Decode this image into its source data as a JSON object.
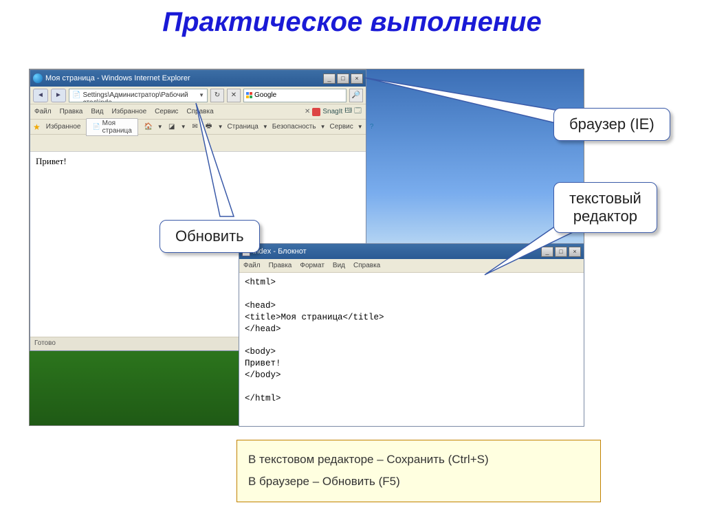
{
  "title": "Практическое выполнение",
  "ie": {
    "title": "Моя страница - Windows Internet Explorer",
    "address": "C:\\Documents and Settings\\Администратор\\Рабочий стол\\inde",
    "search": "Google",
    "menu": {
      "file": "Файл",
      "edit": "Правка",
      "view": "Вид",
      "favorites": "Избранное",
      "service": "Сервис",
      "help": "Справка"
    },
    "snagit": "SnagIt",
    "favbar": {
      "fav": "Избранное",
      "tab": "Моя страница"
    },
    "toolbar": {
      "page": "Страница",
      "security": "Безопасность",
      "service": "Сервис"
    },
    "content": "Привет!",
    "status": "Готово"
  },
  "notepad": {
    "title": "index - Блокнот",
    "menu": {
      "file": "Файл",
      "edit": "Правка",
      "format": "Формат",
      "view": "Вид",
      "help": "Справка"
    },
    "body": "<html>\n\n<head>\n<title>Моя страница</title>\n</head>\n\n<body>\nПривет!\n</body>\n\n</html>"
  },
  "callouts": {
    "refresh": "Обновить",
    "browser": "браузер (IE)",
    "editor": "текстовый\nредактор"
  },
  "instr": {
    "line1": "В текстовом редакторе – Сохранить (Ctrl+S)",
    "line2": "В браузере – Обновить (F5)"
  }
}
